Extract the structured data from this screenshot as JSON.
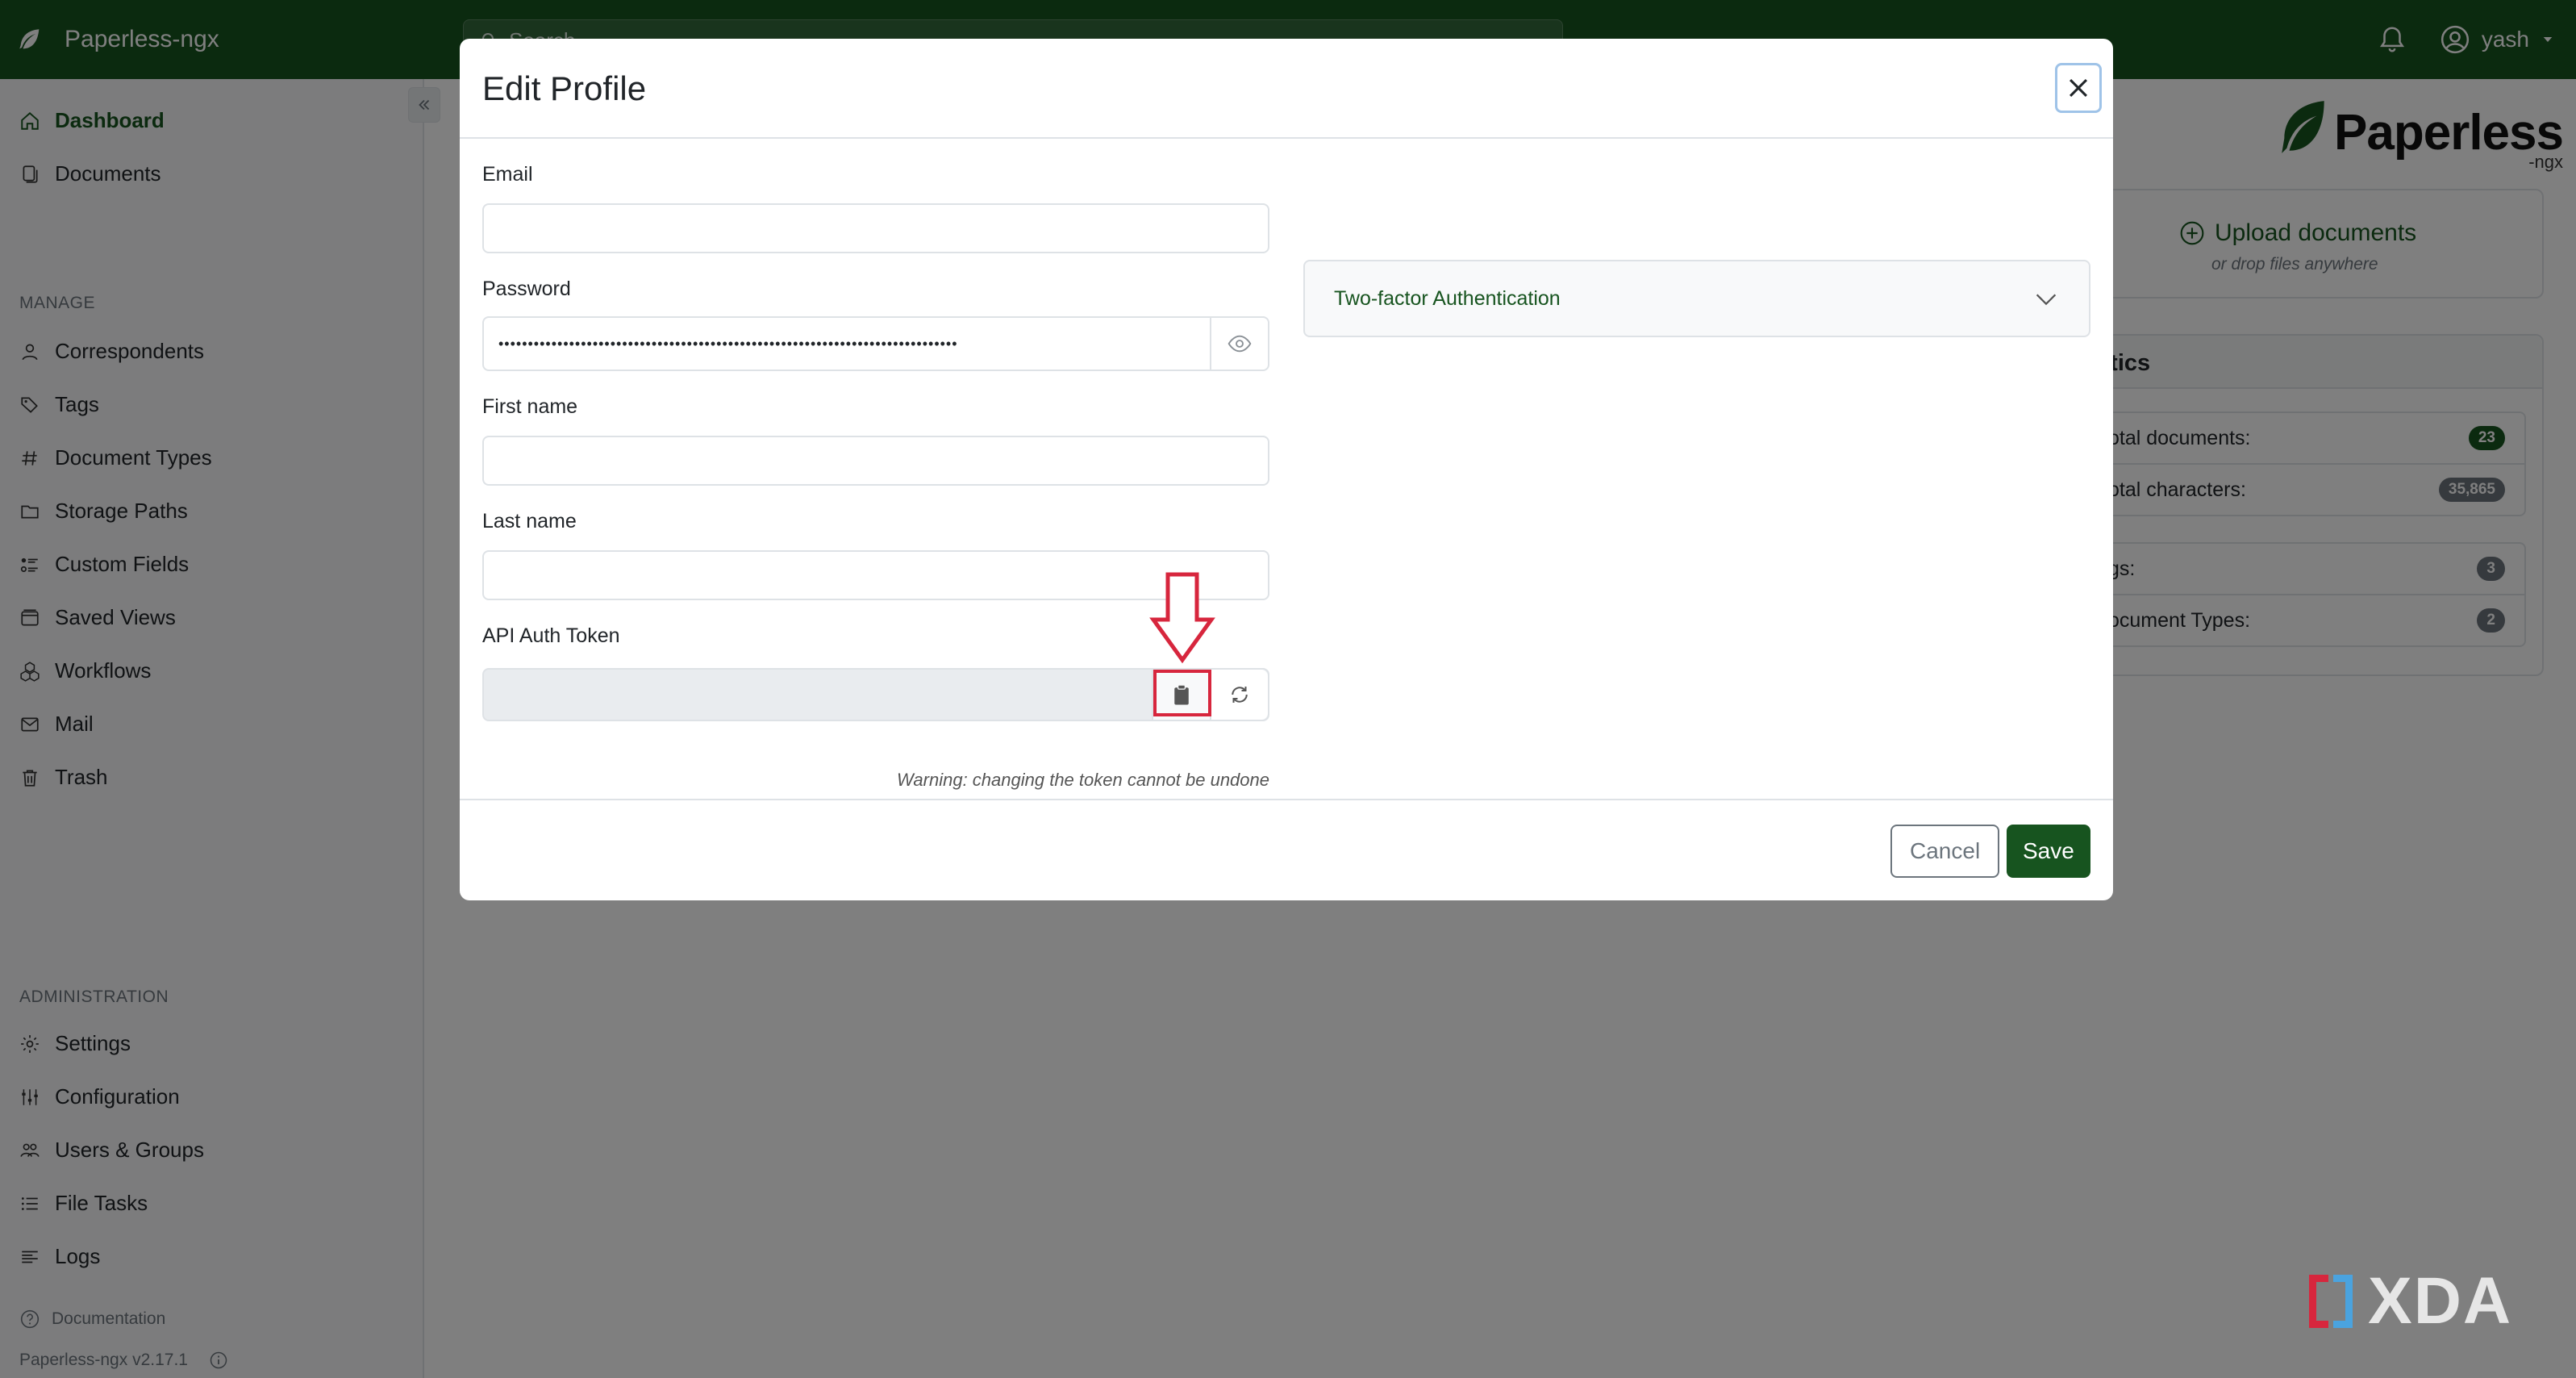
{
  "navbar": {
    "brand": "Paperless-ngx",
    "search_placeholder": "Search",
    "user": "yash"
  },
  "sidebar": {
    "items": [
      {
        "label": "Dashboard",
        "icon": "house-icon",
        "active": true
      },
      {
        "label": "Documents",
        "icon": "files-icon"
      }
    ],
    "manage_heading": "MANAGE",
    "manage_items": [
      {
        "label": "Correspondents",
        "icon": "person-icon"
      },
      {
        "label": "Tags",
        "icon": "tags-icon"
      },
      {
        "label": "Document Types",
        "icon": "hash-icon"
      },
      {
        "label": "Storage Paths",
        "icon": "folder-icon"
      },
      {
        "label": "Custom Fields",
        "icon": "ui-radios-icon"
      },
      {
        "label": "Saved Views",
        "icon": "window-stack-icon"
      },
      {
        "label": "Workflows",
        "icon": "boxes-icon"
      },
      {
        "label": "Mail",
        "icon": "envelope-icon"
      },
      {
        "label": "Trash",
        "icon": "trash-icon"
      }
    ],
    "admin_heading": "ADMINISTRATION",
    "admin_items": [
      {
        "label": "Settings",
        "icon": "gear-icon"
      },
      {
        "label": "Configuration",
        "icon": "sliders-icon"
      },
      {
        "label": "Users & Groups",
        "icon": "people-icon"
      },
      {
        "label": "File Tasks",
        "icon": "list-task-icon"
      },
      {
        "label": "Logs",
        "icon": "text-left-icon"
      }
    ],
    "documentation": "Documentation",
    "version": "Paperless-ngx v2.17.1"
  },
  "dashboard": {
    "logo_word": "Paperless",
    "logo_sub": "-ngx",
    "upload_label": "Upload documents",
    "upload_sub": "or drop files anywhere",
    "stats_title": "istics",
    "stats": [
      {
        "label": "otal documents:",
        "value": "23",
        "color": "#17541f"
      },
      {
        "label": "otal characters:",
        "value": "35,865",
        "color": "#6c757d"
      },
      {
        "label": "gs:",
        "value": "3",
        "color": "#6c757d"
      },
      {
        "label": "ocument Types:",
        "value": "2",
        "color": "#6c757d"
      }
    ]
  },
  "modal": {
    "title": "Edit Profile",
    "email_label": "Email",
    "email_value": "",
    "password_label": "Password",
    "password_value": "••••••••••••••••••••••••••••••••••••••••••••••••••••••••••••••••••••••••••••••",
    "first_name_label": "First name",
    "first_name_value": "",
    "last_name_label": "Last name",
    "last_name_value": "",
    "token_label": "API Auth Token",
    "token_value": "",
    "token_warning": "Warning: changing the token cannot be undone",
    "twofa_label": "Two-factor Authentication",
    "cancel_label": "Cancel",
    "save_label": "Save"
  },
  "colors": {
    "brand": "#17541f",
    "highlight": "#d7263d"
  },
  "watermark": "XDA"
}
